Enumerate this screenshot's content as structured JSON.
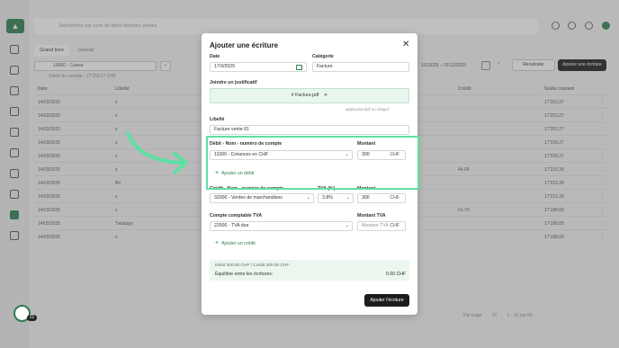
{
  "background": {
    "search_placeholder": "Recherche par nom de dans factures ventes",
    "tabs": [
      "Grand livre",
      "Journal"
    ],
    "account_select": "10000 - Caisse",
    "balance": "Solde du compte : 17'253.27 CHF",
    "daterange": "1/1/2025 – 31/12/2025",
    "recalc": "Recalculer",
    "add_entry": "Ajouter une écriture",
    "columns": [
      "Date",
      "Libellé",
      "Crédit",
      "Solde courant"
    ],
    "rows": [
      {
        "date": "14/03/2025",
        "label": "s",
        "credit": "",
        "balance": "17'253.27"
      },
      {
        "date": "14/03/2025",
        "label": "s",
        "credit": "",
        "balance": "17'253.27"
      },
      {
        "date": "14/03/2025",
        "label": "s",
        "credit": "",
        "balance": "17'253.27"
      },
      {
        "date": "14/03/2025",
        "label": "s",
        "credit": "",
        "balance": "17'238.27"
      },
      {
        "date": "14/03/2025",
        "label": "s",
        "credit": "",
        "balance": "17'238.27"
      },
      {
        "date": "14/03/2025",
        "label": "s",
        "credit": "44.00",
        "balance": "17'215.39"
      },
      {
        "date": "14/03/2025",
        "label": "Bit",
        "credit": "",
        "balance": "17'215.39"
      },
      {
        "date": "14/03/2025",
        "label": "s",
        "credit": "",
        "balance": "17'215.39"
      },
      {
        "date": "14/03/2025",
        "label": "s",
        "credit": "61.70",
        "balance": "17'188.09"
      },
      {
        "date": "14/03/2025",
        "label": "Twistapp",
        "credit": "",
        "balance": "17'188.09"
      },
      {
        "date": "14/03/2025",
        "label": "s",
        "credit": "",
        "balance": "17'188.09"
      }
    ],
    "pager": {
      "per_page_label": "Par page",
      "per_page": "10",
      "range": "1 - 10 sur 69"
    },
    "help_badge": "21"
  },
  "modal": {
    "title": "Ajouter une écriture",
    "date_label": "Date",
    "date_value": "17/3/2025",
    "category_label": "Catégorie",
    "category_value": "Facture",
    "attach_label": "Joindre un justificatif",
    "attach_file": "# Facture.pdf",
    "attach_hint": "application/pdf ou image/*",
    "libelle_label": "Libellé",
    "libelle_value": "Facture vente 01",
    "debit_label": "Débit - Nom - numéro de compte",
    "debit_amount_label": "Montant",
    "debit_account": "11000 - Créances en CHF",
    "debit_amount": "300",
    "currency": "CHF",
    "add_debit": "Ajouter un débit",
    "credit_label": "Crédit - Nom - numéro de compte",
    "tva_label": "TVA (%)",
    "credit_amount_label": "Montant",
    "credit_account": "32000 - Ventes de marchandises",
    "tva_rate": "3.8%",
    "credit_amount": "300",
    "vat_account_label": "Compte comptable TVA",
    "vat_amount_label": "Montant TVA",
    "vat_account": "22000 - TVA due",
    "vat_amount_placeholder": "Montant TVA",
    "add_credit": "Ajouter un crédit",
    "summary_line": "Débit 300.00 CHF / Crédit 300.00 CHF",
    "balance_label": "Équilibre entre les écritures:",
    "balance_value": "0.00 CHF",
    "submit": "Ajouter l'écriture"
  },
  "colors": {
    "accent": "#2e7d4f",
    "highlight": "#5fe0a3"
  }
}
